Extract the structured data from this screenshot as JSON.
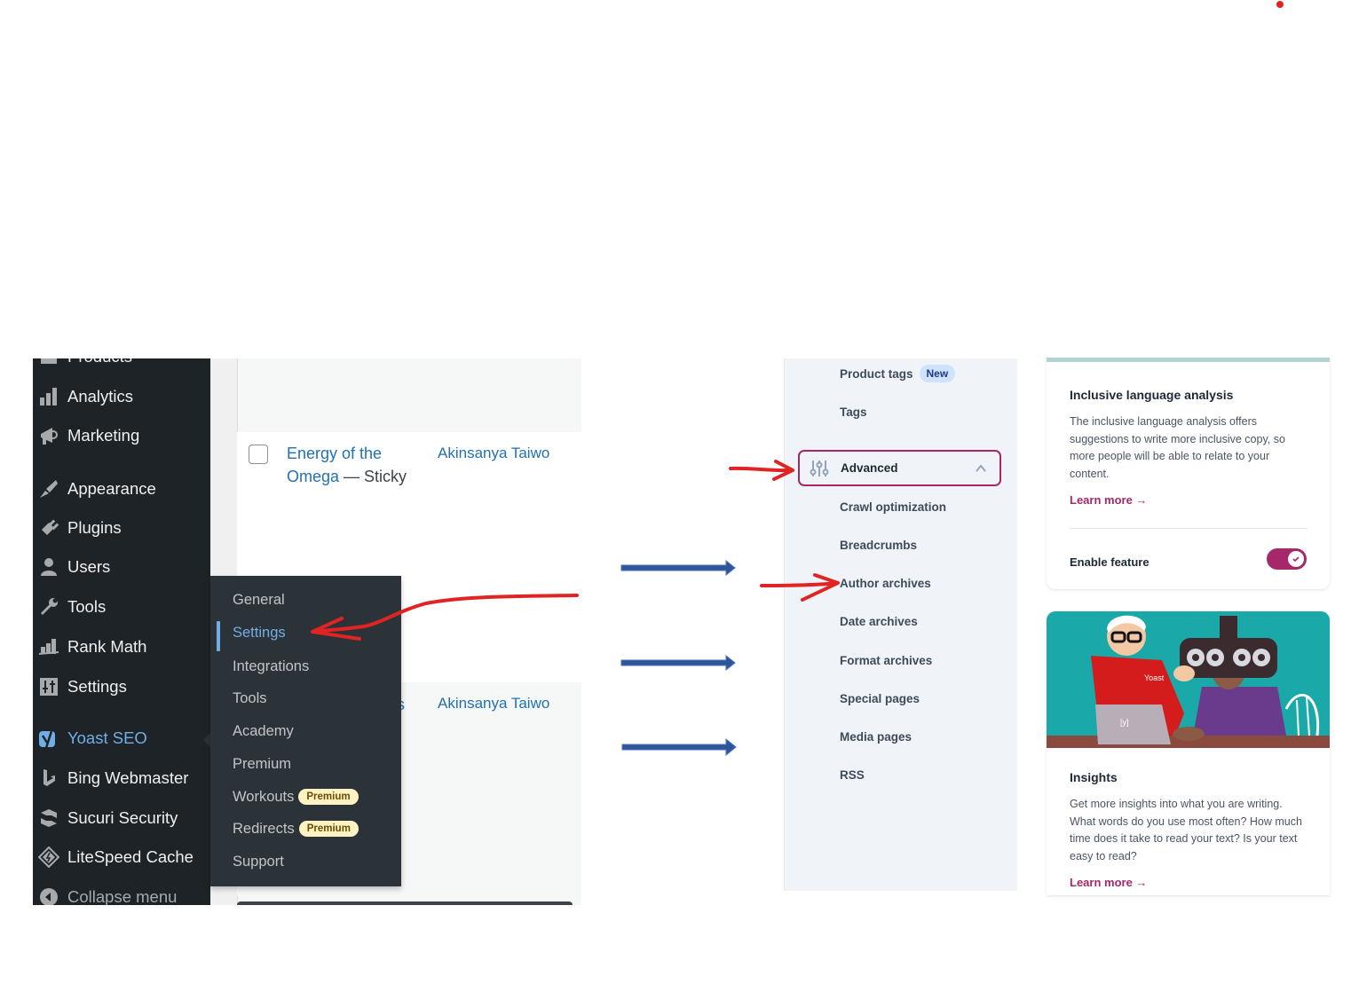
{
  "wp_admin": {
    "sidebar": {
      "items": [
        {
          "label": "Products",
          "icon": "products-icon"
        },
        {
          "label": "Analytics",
          "icon": "analytics-bar-chart-icon"
        },
        {
          "label": "Marketing",
          "icon": "megaphone-icon"
        },
        {
          "label": "Appearance",
          "icon": "paintbrush-icon"
        },
        {
          "label": "Plugins",
          "icon": "plug-icon"
        },
        {
          "label": "Users",
          "icon": "user-icon"
        },
        {
          "label": "Tools",
          "icon": "wrench-icon"
        },
        {
          "label": "Rank Math",
          "icon": "rank-math-icon"
        },
        {
          "label": "Settings",
          "icon": "settings-sliders-icon"
        },
        {
          "label": "Yoast SEO",
          "icon": "yoast-logo-icon",
          "active": true
        },
        {
          "label": "Bing Webmaster",
          "icon": "bing-logo-icon"
        },
        {
          "label": "Sucuri Security",
          "icon": "sucuri-logo-icon"
        },
        {
          "label": "LiteSpeed Cache",
          "icon": "litespeed-diamond-icon"
        },
        {
          "label": "Collapse menu",
          "icon": "collapse-arrow-icon"
        }
      ]
    },
    "yoast_submenu": {
      "items": [
        {
          "label": "General"
        },
        {
          "label": "Settings",
          "active": true
        },
        {
          "label": "Integrations"
        },
        {
          "label": "Tools"
        },
        {
          "label": "Academy"
        },
        {
          "label": "Premium"
        },
        {
          "label": "Workouts",
          "badge": "Premium"
        },
        {
          "label": "Redirects",
          "badge": "Premium"
        },
        {
          "label": "Support"
        }
      ]
    },
    "posts": [
      {
        "title": "Energy of the Omega",
        "state": "— Sticky",
        "author": "Akinsanya Taiwo"
      },
      {
        "title_fragment": "s",
        "author": "Akinsanya Taiwo"
      }
    ]
  },
  "yoast_settings_nav": {
    "items_top": [
      {
        "label": "Product tags",
        "badge": "New"
      },
      {
        "label": "Tags"
      }
    ],
    "advanced_section": {
      "label": "Advanced",
      "icon": "adjustments-sliders-icon",
      "expanded": true
    },
    "advanced_items": [
      {
        "label": "Crawl optimization"
      },
      {
        "label": "Breadcrumbs"
      },
      {
        "label": "Author archives"
      },
      {
        "label": "Date archives"
      },
      {
        "label": "Format archives"
      },
      {
        "label": "Special pages"
      },
      {
        "label": "Media pages"
      },
      {
        "label": "RSS"
      }
    ]
  },
  "feature_cards": {
    "inclusive": {
      "title": "Inclusive language analysis",
      "description": "The inclusive language analysis offers suggestions to write more inclusive copy, so more people will be able to relate to your content.",
      "link": "Learn more →",
      "enable_label": "Enable feature",
      "enabled": true
    },
    "insights": {
      "illustration": "optometrist-illustration",
      "shirt_text": "Yoast",
      "laptop_logo": "[y]",
      "title": "Insights",
      "description": "Get more insights into what you are writing. What words do you use most often? How much time does it take to read your text? Is your text easy to read?",
      "link": "Learn more →"
    }
  },
  "annotations": {
    "red_arrows": [
      "to-yoast-settings",
      "to-advanced",
      "to-author-archives"
    ],
    "blue_arrows": 3,
    "red_color": "#e02424",
    "blue_color": "#2f5597"
  }
}
